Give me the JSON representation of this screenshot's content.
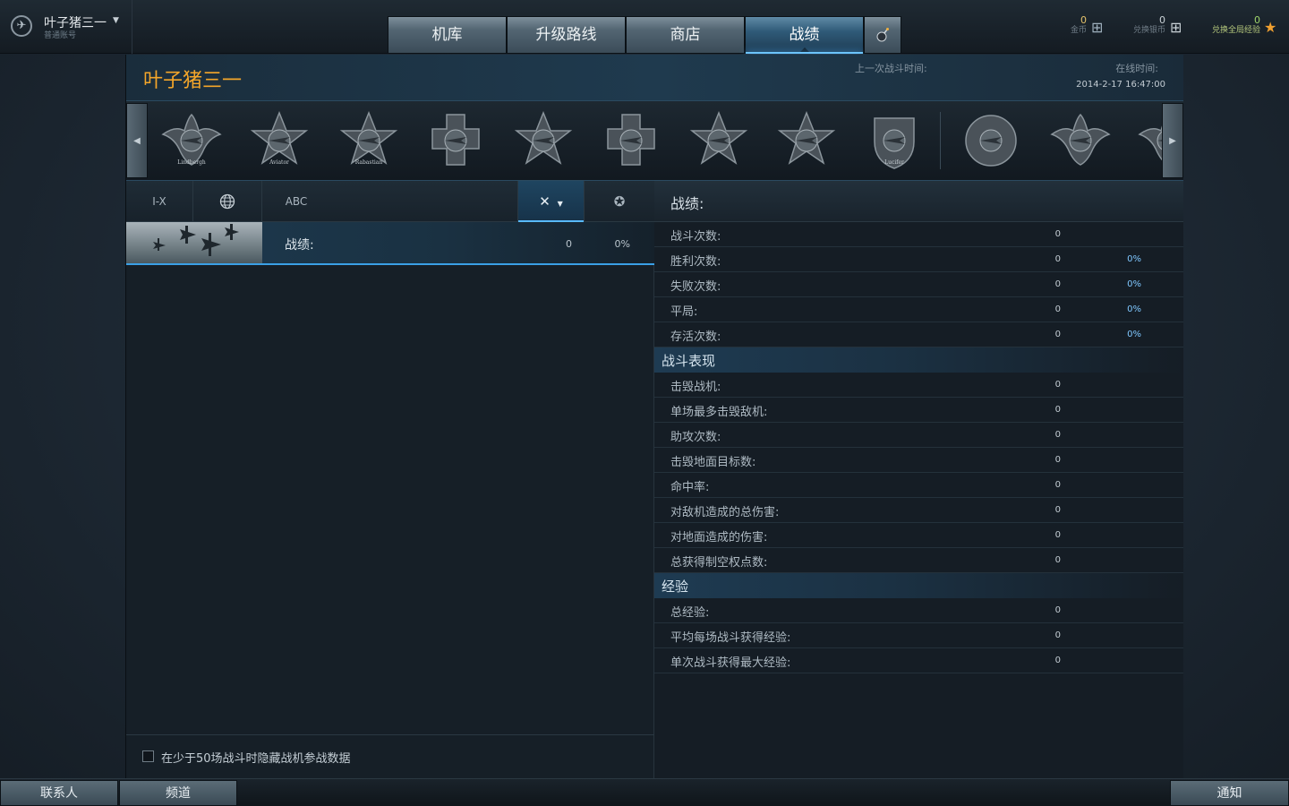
{
  "account": {
    "name": "叶子猪三一",
    "type": "普通账号"
  },
  "nav": {
    "tabs": [
      "机库",
      "升级路线",
      "商店",
      "战绩"
    ],
    "active": "战绩"
  },
  "currency": [
    {
      "value": "0",
      "label": "金币"
    },
    {
      "value": "0",
      "label": "兑换银币"
    },
    {
      "value": "0",
      "label": "兑换全局经验"
    }
  ],
  "header": {
    "player_name": "叶子猪三一",
    "last_battle_label": "上一次战斗时间:",
    "online_label": "在线时间:",
    "online_value": "2014-2-17 16:47:00"
  },
  "medal_labels": [
    "Lindbergh",
    "Aviator",
    "Rabastian",
    "",
    "",
    "",
    "",
    "",
    "Lucifer",
    "",
    "",
    ""
  ],
  "filters": {
    "tier": "I-X",
    "sort_name": "ABC"
  },
  "plane_row": {
    "label": "战绩:",
    "value": "0",
    "percent": "0%"
  },
  "hide_option": "在少于50场战斗时隐藏战机参战数据",
  "stats": {
    "title": "战绩:",
    "general": [
      {
        "label": "战斗次数:",
        "value": "0",
        "percent": ""
      },
      {
        "label": "胜利次数:",
        "value": "0",
        "percent": "0%"
      },
      {
        "label": "失败次数:",
        "value": "0",
        "percent": "0%"
      },
      {
        "label": "平局:",
        "value": "0",
        "percent": "0%"
      },
      {
        "label": "存活次数:",
        "value": "0",
        "percent": "0%"
      }
    ],
    "performance_title": "战斗表现",
    "performance": [
      {
        "label": "击毁战机:",
        "value": "0"
      },
      {
        "label": "单场最多击毁敌机:",
        "value": "0"
      },
      {
        "label": "助攻次数:",
        "value": "0"
      },
      {
        "label": "击毁地面目标数:",
        "value": "0"
      },
      {
        "label": "命中率:",
        "value": "0"
      },
      {
        "label": "对敌机造成的总伤害:",
        "value": "0"
      },
      {
        "label": "对地面造成的伤害:",
        "value": "0"
      },
      {
        "label": "总获得制空权点数:",
        "value": "0"
      }
    ],
    "experience_title": "经验",
    "experience": [
      {
        "label": "总经验:",
        "value": "0"
      },
      {
        "label": "平均每场战斗获得经验:",
        "value": "0"
      },
      {
        "label": "单次战斗获得最大经验:",
        "value": "0"
      }
    ]
  },
  "bottom": {
    "contacts": "联系人",
    "channels": "频道",
    "notifications": "通知"
  },
  "colors": {
    "accent": "#58b9ff",
    "player_name": "#f4a62a",
    "gold": "#e2c16b"
  }
}
